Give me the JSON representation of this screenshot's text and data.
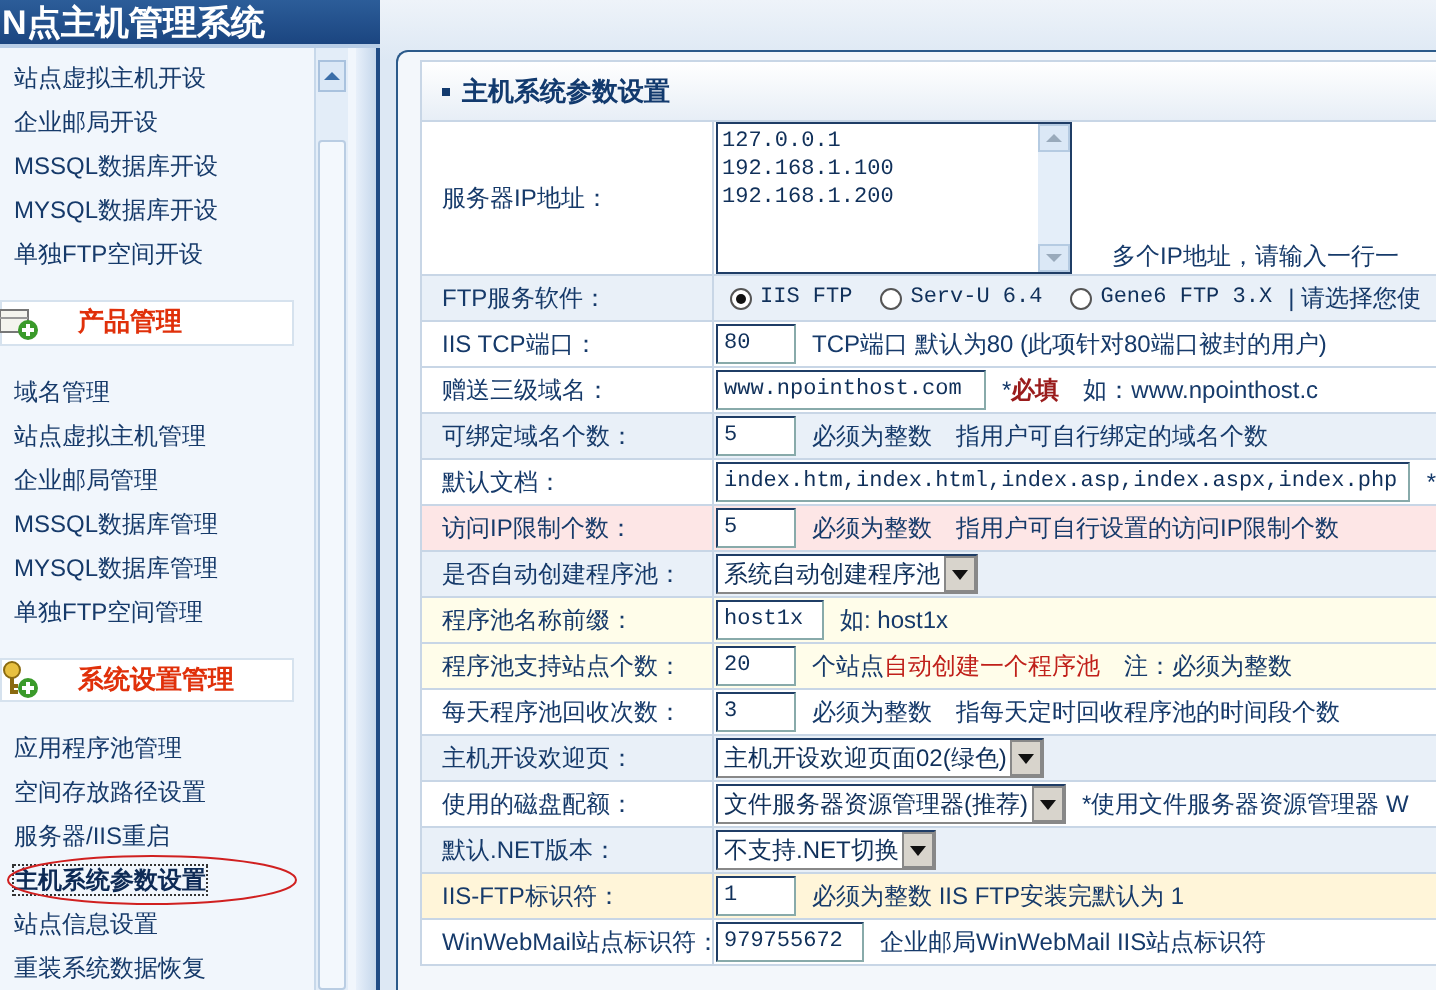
{
  "header": {
    "logo": "N点主机管理系统"
  },
  "sidebar": {
    "items_top": [
      {
        "label": "站点虚拟主机开设",
        "selected": false
      },
      {
        "label": "企业邮局开设",
        "selected": false
      },
      {
        "label": "MSSQL数据库开设",
        "selected": false
      },
      {
        "label": "MYSQL数据库开设",
        "selected": false
      },
      {
        "label": "单独FTP空间开设",
        "selected": false
      }
    ],
    "sections": [
      {
        "title": "产品管理",
        "kind": "product",
        "items": [
          {
            "label": "域名管理",
            "selected": false
          },
          {
            "label": "站点虚拟主机管理",
            "selected": false
          },
          {
            "label": "企业邮局管理",
            "selected": false
          },
          {
            "label": "MSSQL数据库管理",
            "selected": false
          },
          {
            "label": "MYSQL数据库管理",
            "selected": false
          },
          {
            "label": "单独FTP空间管理",
            "selected": false
          }
        ]
      },
      {
        "title": "系统设置管理",
        "kind": "system",
        "items": [
          {
            "label": "应用程序池管理",
            "selected": false
          },
          {
            "label": "空间存放路径设置",
            "selected": false
          },
          {
            "label": "服务器/IIS重启",
            "selected": false
          },
          {
            "label": "主机系统参数设置",
            "selected": true
          },
          {
            "label": "站点信息设置",
            "selected": false
          },
          {
            "label": "重装系统数据恢复",
            "selected": false
          }
        ]
      }
    ]
  },
  "panel": {
    "title": "主机系统参数设置",
    "rows": [
      {
        "label": "服务器IP地址：",
        "color": "#ffffff",
        "kind": "textarea",
        "value": "127.0.0.1\n192.168.1.100\n192.168.1.200",
        "notes": [
          {
            "parts": [
              {
                "text": "多个IP地址，请输入一行一",
                "kind": "plain"
              }
            ]
          }
        ]
      },
      {
        "label": "FTP服务软件：",
        "color": "#e9f0f8",
        "kind": "radio",
        "options": [
          {
            "label": "IIS FTP",
            "selected": true
          },
          {
            "label": "Serv-U 6.4",
            "selected": false
          },
          {
            "label": "Gene6 FTP 3.X",
            "selected": false
          }
        ],
        "notes": [
          {
            "parts": [
              {
                "text": "| 请选择您使",
                "kind": "plain"
              }
            ]
          }
        ]
      },
      {
        "label": "IIS TCP端口：",
        "color": "#ffffff",
        "kind": "input",
        "value": "80",
        "notes": [
          {
            "parts": [
              {
                "text": "TCP端口 默认为80 (此项针对80端口被封的用户)",
                "kind": "plain"
              }
            ]
          }
        ]
      },
      {
        "label": "赠送三级域名：",
        "color": "#ffffff",
        "kind": "input",
        "value": "www.npointhost.com",
        "notes": [
          {
            "parts": [
              {
                "text": "*",
                "kind": "plain"
              },
              {
                "text": "必填",
                "kind": "required"
              }
            ]
          },
          {
            "parts": [
              {
                "text": "如：www.npointhost.c",
                "kind": "plain"
              }
            ]
          }
        ]
      },
      {
        "label": "可绑定域名个数：",
        "color": "#e9f0f8",
        "kind": "input",
        "value": "5",
        "notes": [
          {
            "parts": [
              {
                "text": "必须为整数",
                "kind": "plain"
              }
            ]
          },
          {
            "parts": [
              {
                "text": "指用户可自行绑定的域名个数",
                "kind": "plain"
              }
            ]
          }
        ]
      },
      {
        "label": "默认文档：",
        "color": "#ffffff",
        "kind": "input",
        "value": "index.htm,index.html,index.asp,index.aspx,index.php",
        "notes": [
          {
            "parts": [
              {
                "text": "*",
                "kind": "plain"
              }
            ]
          }
        ]
      },
      {
        "label": "访问IP限制个数：",
        "color": "#fde6e6",
        "kind": "input",
        "value": "5",
        "notes": [
          {
            "parts": [
              {
                "text": "必须为整数",
                "kind": "plain"
              }
            ]
          },
          {
            "parts": [
              {
                "text": "指用户可自行设置的访问IP限制个数",
                "kind": "plain"
              }
            ]
          }
        ]
      },
      {
        "label": "是否自动创建程序池：",
        "color": "#e9f0f8",
        "kind": "select",
        "value": "系统自动创建程序池",
        "notes": []
      },
      {
        "label": "程序池名称前缀：",
        "color": "#fffdea",
        "kind": "input",
        "value": "host1x",
        "notes": [
          {
            "parts": [
              {
                "text": "如: host1x",
                "kind": "plain"
              }
            ]
          }
        ]
      },
      {
        "label": "程序池支持站点个数：",
        "color": "#fffdea",
        "kind": "input",
        "value": "20",
        "notes": [
          {
            "parts": [
              {
                "text": "个站点",
                "kind": "plain"
              },
              {
                "text": "自动创建一个程序池",
                "kind": "alert"
              }
            ]
          },
          {
            "parts": [
              {
                "text": "注：必须为整数",
                "kind": "plain"
              }
            ]
          }
        ]
      },
      {
        "label": "每天程序池回收次数：",
        "color": "#ffffff",
        "kind": "input",
        "value": "3",
        "notes": [
          {
            "parts": [
              {
                "text": "必须为整数",
                "kind": "plain"
              }
            ]
          },
          {
            "parts": [
              {
                "text": "指每天定时回收程序池的时间段个数",
                "kind": "plain"
              }
            ]
          }
        ]
      },
      {
        "label": "主机开设欢迎页：",
        "color": "#e9f0f8",
        "kind": "select",
        "value": "主机开设欢迎页面02(绿色)",
        "notes": []
      },
      {
        "label": "使用的磁盘配额：",
        "color": "#ffffff",
        "kind": "select",
        "value": "文件服务器资源管理器(推荐)",
        "notes": [
          {
            "parts": [
              {
                "text": "*使用文件服务器资源管理器 W",
                "kind": "plain"
              }
            ]
          }
        ]
      },
      {
        "label": "默认.NET版本：",
        "color": "#e9f0f8",
        "kind": "select",
        "value": "不支持.NET切换",
        "notes": []
      },
      {
        "label": "IIS-FTP标识符：",
        "color": "#fff5d9",
        "kind": "input",
        "value": "1",
        "notes": [
          {
            "parts": [
              {
                "text": "必须为整数 IIS FTP安装完默认为 1",
                "kind": "plain"
              }
            ]
          }
        ]
      },
      {
        "label": "WinWebMail站点标识符：",
        "color": "#ffffff",
        "kind": "input",
        "value": "979755672",
        "notes": [
          {
            "parts": [
              {
                "text": "企业邮局WinWebMail IIS站点标识符",
                "kind": "plain"
              }
            ]
          }
        ]
      }
    ]
  }
}
